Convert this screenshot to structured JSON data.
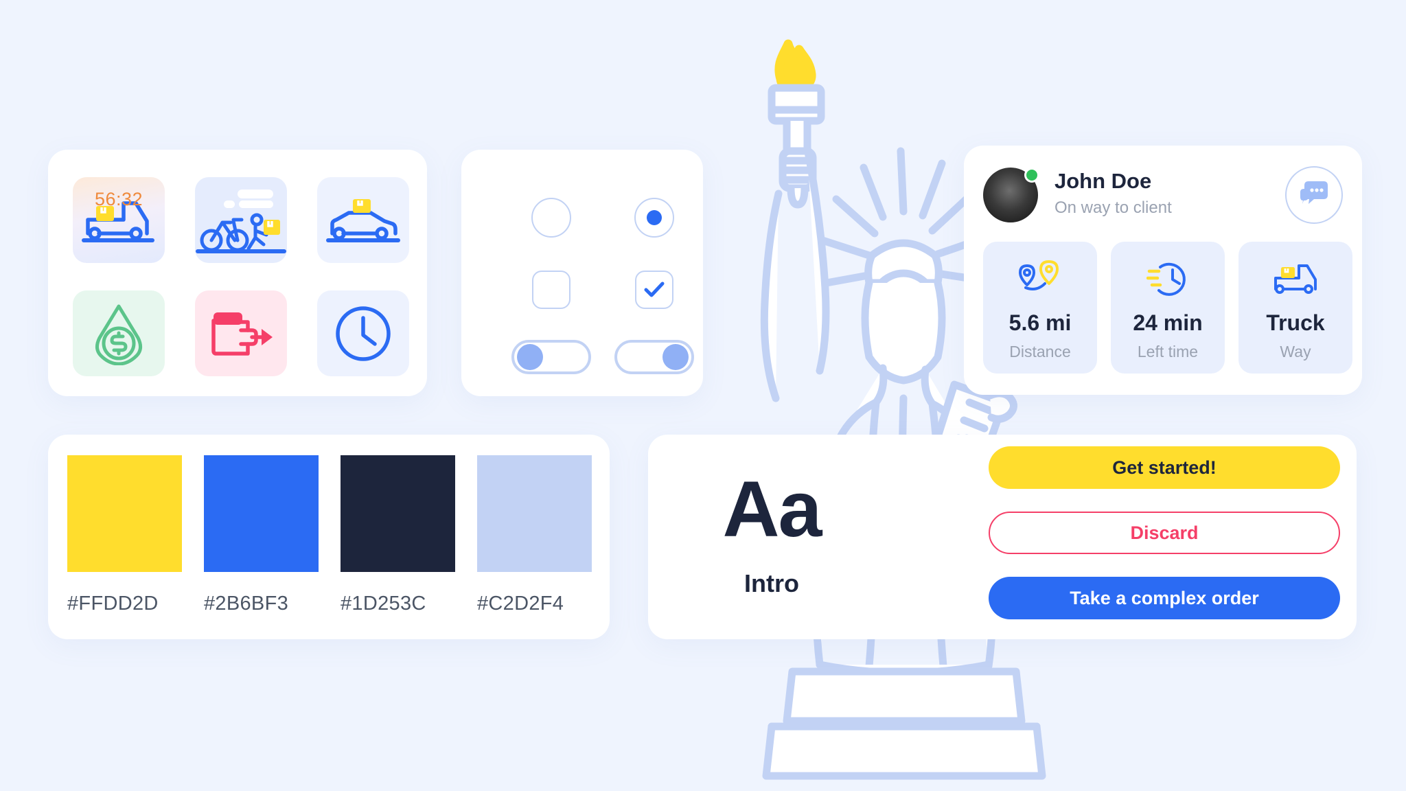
{
  "background_color": "#EFF4FE",
  "icons_panel": {
    "name": "icon-tiles",
    "timer_value": "56:32",
    "tiles": [
      {
        "name": "truck-delivery-icon",
        "bg": "gradient-peach"
      },
      {
        "name": "bike-courier-icon",
        "bg": "#E5ECFD"
      },
      {
        "name": "taxi-car-icon",
        "bg": "#EDF2FE"
      },
      {
        "name": "money-drop-icon",
        "bg": "#E7F7EE"
      },
      {
        "name": "wallet-payout-icon",
        "bg": "#FFE7EE"
      },
      {
        "name": "clock-icon",
        "bg": "#EDF2FE"
      }
    ]
  },
  "controls_panel": {
    "radio_off": "off",
    "radio_on": "on",
    "checkbox_off": "off",
    "checkbox_on": "checked",
    "switch_off": "off",
    "switch_on": "on"
  },
  "palette": {
    "swatches": [
      {
        "hex": "#FFDD2D",
        "label": "#FFDD2D"
      },
      {
        "hex": "#2B6BF3",
        "label": "#2B6BF3"
      },
      {
        "hex": "#1D253C",
        "label": "#1D253C"
      },
      {
        "hex": "#C2D2F4",
        "label": "#C2D2F4"
      }
    ]
  },
  "typography": {
    "sample": "Aa",
    "font_name": "Intro"
  },
  "driver_card": {
    "name": "John Doe",
    "status": "On way to client",
    "online": true,
    "chat_icon": "chat-bubbles-icon",
    "stats": [
      {
        "icon": "route-pin-icon",
        "value": "5.6 mi",
        "label": "Distance"
      },
      {
        "icon": "clock-speed-icon",
        "value": "24 min",
        "label": "Left time"
      },
      {
        "icon": "truck-icon",
        "value": "Truck",
        "label": "Way"
      }
    ]
  },
  "actions": {
    "primary": "Get started!",
    "discard": "Discard",
    "complex": "Take a complex order"
  },
  "illustration": {
    "name": "statue-of-liberty-illustration",
    "outline_color": "#C2D2F4",
    "flame_color": "#FFDD2D"
  }
}
